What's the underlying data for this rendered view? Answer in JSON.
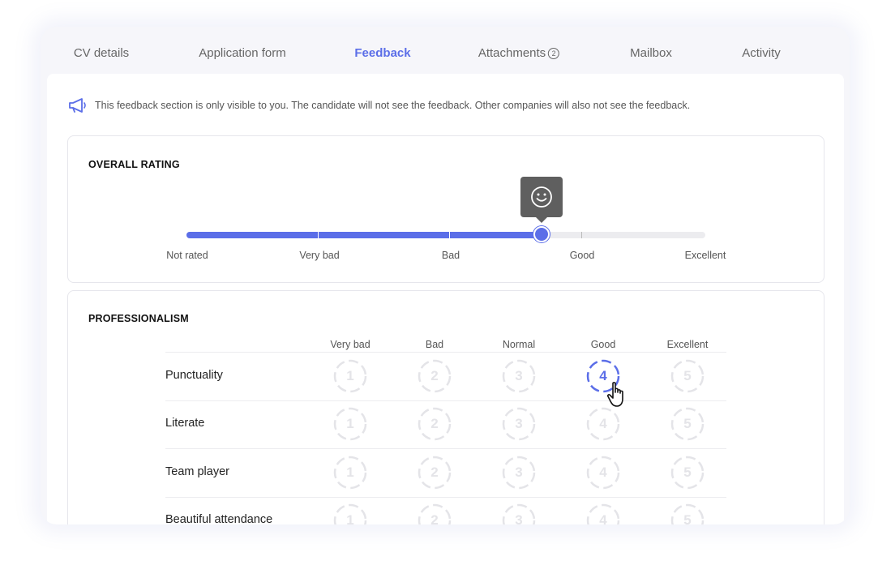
{
  "tabs": [
    {
      "label": "CV details",
      "active": false
    },
    {
      "label": "Application form",
      "active": false
    },
    {
      "label": "Feedback",
      "active": true
    },
    {
      "label": "Attachments",
      "badge": "2",
      "active": false
    },
    {
      "label": "Mailbox",
      "active": false
    },
    {
      "label": "Activity",
      "active": false
    }
  ],
  "notice": {
    "icon": "megaphone-icon",
    "text": "This feedback section is only visible to you. The candidate will not see the feedback. Other companies will also not see the feedback."
  },
  "overall_rating": {
    "title": "OVERALL RATING",
    "levels": [
      "Not rated",
      "Very bad",
      "Bad",
      "Good",
      "Excellent"
    ],
    "value_fraction": 0.685,
    "tooltip_icon": "smiley-icon"
  },
  "professionalism": {
    "title": "PROFESSIONALISM",
    "columns": [
      "Very bad",
      "Bad",
      "Normal",
      "Good",
      "Excellent"
    ],
    "scale": [
      "1",
      "2",
      "3",
      "4",
      "5"
    ],
    "rows": [
      {
        "label": "Punctuality",
        "selected": 4
      },
      {
        "label": "Literate",
        "selected": null
      },
      {
        "label": "Team player",
        "selected": null
      },
      {
        "label": "Beautiful attendance",
        "selected": null
      }
    ]
  },
  "colors": {
    "accent": "#5b6ee8",
    "tooltip_bg": "#5f5f5f",
    "inactive_circle": "#e4e4e8"
  }
}
